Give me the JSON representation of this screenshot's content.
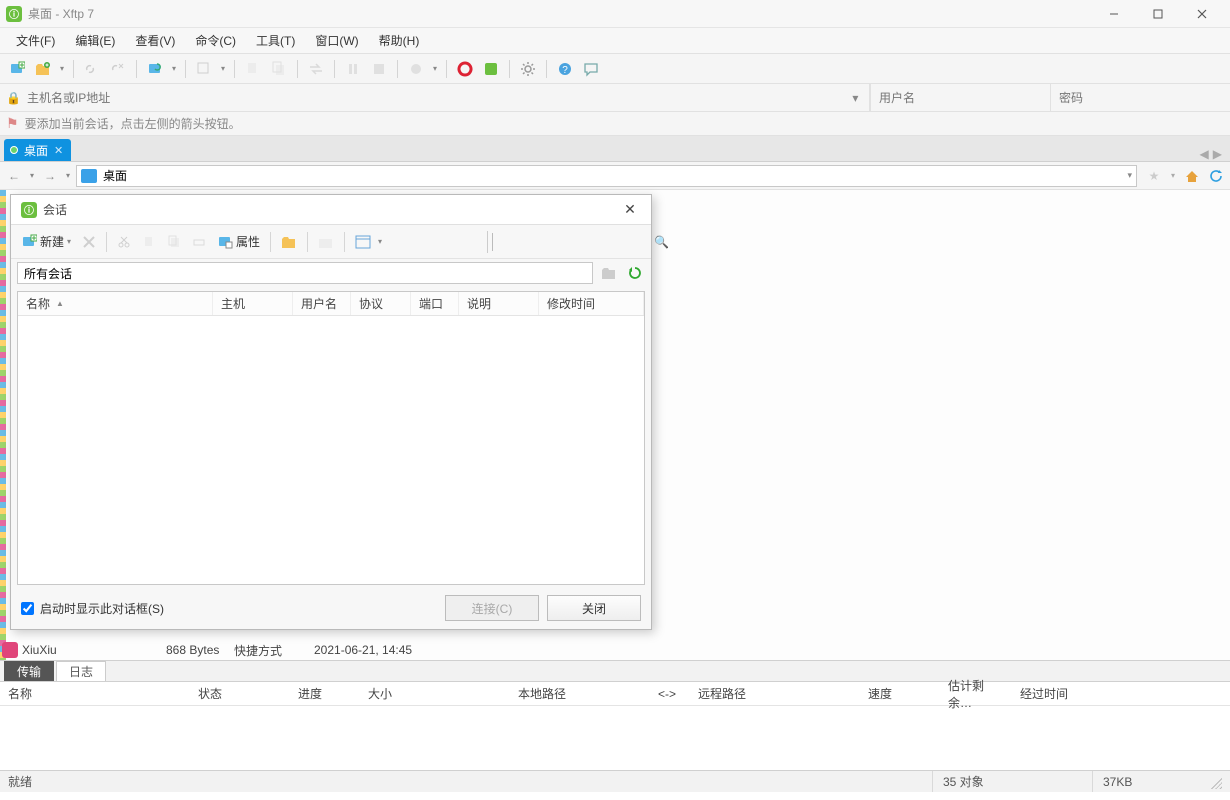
{
  "window": {
    "title": "桌面 - Xftp 7"
  },
  "menubar": [
    "文件(F)",
    "编辑(E)",
    "查看(V)",
    "命令(C)",
    "工具(T)",
    "窗口(W)",
    "帮助(H)"
  ],
  "conn": {
    "host_placeholder": "主机名或IP地址",
    "user_placeholder": "用户名",
    "pass_placeholder": "密码"
  },
  "hint": "要添加当前会话，点击左侧的箭头按钮。",
  "session_tab": {
    "label": "桌面"
  },
  "addr": {
    "path": "桌面"
  },
  "dialog": {
    "title": "会话",
    "new_label": "新建",
    "props_label": "属性",
    "path_value": "所有会话",
    "columns": [
      "名称",
      "主机",
      "用户名",
      "协议",
      "端口",
      "说明",
      "修改时间"
    ],
    "startup_checkbox": "启动时显示此对话框(S)",
    "connect_btn": "连接(C)",
    "close_btn": "关闭"
  },
  "file_row": {
    "name": "XiuXiu",
    "size": "868 Bytes",
    "type": "快捷方式",
    "modified": "2021-06-21, 14:45"
  },
  "transfer_tabs": {
    "tab1": "传输",
    "tab2": "日志"
  },
  "transfer_columns": [
    "名称",
    "状态",
    "进度",
    "大小",
    "本地路径",
    "<->",
    "远程路径",
    "速度",
    "估计剩余…",
    "经过时间"
  ],
  "status": {
    "ready": "就绪",
    "objects": "35 对象",
    "size": "37KB"
  }
}
